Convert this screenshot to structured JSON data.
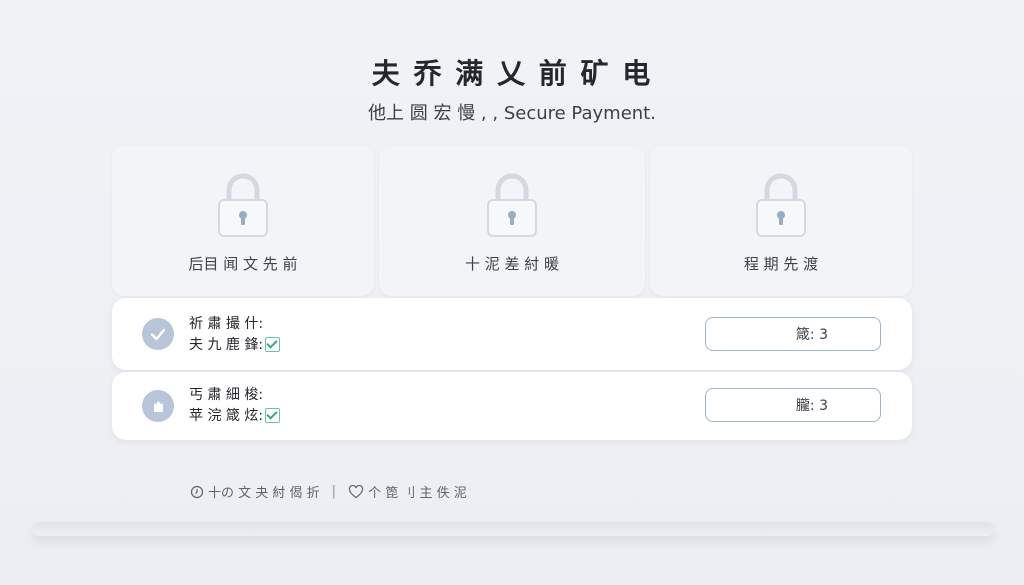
{
  "header": {
    "title": "夫 乔 满 乂 前 矿 电",
    "subtitle": "他上 圆 宏 慢 , ,  Secure  Payment."
  },
  "cards": [
    {
      "label": "后目 闻 文 先 前",
      "icon": "lock-icon"
    },
    {
      "label": "十 泥 差 紂 暖",
      "icon": "lock-icon"
    },
    {
      "label": "程 期 先 渡",
      "icon": "lock-icon"
    }
  ],
  "items": [
    {
      "line1": "祈 肅 撮 什:",
      "line2": "夫 九 鹿 鋒:",
      "qty_label": "箴:  3",
      "avatar_icon": "check-circle-icon"
    },
    {
      "line1": "丐 肅 細 梭:",
      "line2": "苹 浣 箴 炫:",
      "qty_label": "朧:  3",
      "avatar_icon": "hands-icon"
    }
  ],
  "footer": {
    "left": "十の 文 夬 紂 偈 折",
    "separator": "|",
    "right": "个 箆 刂 主 佚 泥"
  },
  "colors": {
    "background": "#eef0f4",
    "card": "#f3f4f7",
    "row": "#ffffff",
    "accent_check": "#3aa888",
    "qty_border": "#9fb4c4",
    "avatar": "#b8c5d9"
  }
}
